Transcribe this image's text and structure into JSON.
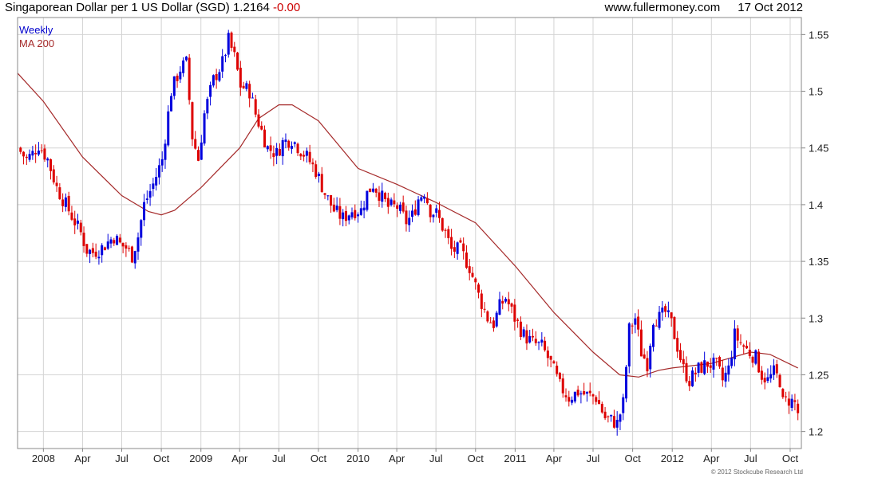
{
  "header": {
    "title": "Singaporean Dollar per 1 US Dollar (SGD)",
    "last_value": "1.2164",
    "change": "-0.00",
    "website": "www.fullermoney.com",
    "date": "17 Oct 2012"
  },
  "credit": "© 2012 Stockcube Research Ltd",
  "colors": {
    "up": "#0000dd",
    "down": "#dd0000",
    "ma": "#a52a2a",
    "grid": "#d4d4d4",
    "frame": "#888888"
  },
  "chart_data": {
    "type": "candlestick",
    "legend": [
      "Weekly",
      "MA 200"
    ],
    "legend_placement": "top-left",
    "grid": true,
    "y_axis_side": "right",
    "ylim": [
      1.185,
      1.565
    ],
    "y_ticks": [
      1.2,
      1.25,
      1.3,
      1.35,
      1.4,
      1.45,
      1.5,
      1.55
    ],
    "y_tick_labels": [
      "1.2",
      "1.25",
      "1.3",
      "1.35",
      "1.4",
      "1.45",
      "1.5",
      "1.55"
    ],
    "xlim": [
      "2007-11-02",
      "2012-10-27"
    ],
    "x_ticks": [
      {
        "date": "2008-01-01",
        "label": "2008"
      },
      {
        "date": "2008-04-01",
        "label": "Apr"
      },
      {
        "date": "2008-07-01",
        "label": "Jul"
      },
      {
        "date": "2008-10-01",
        "label": "Oct"
      },
      {
        "date": "2009-01-01",
        "label": "2009"
      },
      {
        "date": "2009-04-01",
        "label": "Apr"
      },
      {
        "date": "2009-07-01",
        "label": "Jul"
      },
      {
        "date": "2009-10-01",
        "label": "Oct"
      },
      {
        "date": "2010-01-01",
        "label": "2010"
      },
      {
        "date": "2010-04-01",
        "label": "Apr"
      },
      {
        "date": "2010-07-01",
        "label": "Jul"
      },
      {
        "date": "2010-10-01",
        "label": "Oct"
      },
      {
        "date": "2011-01-01",
        "label": "2011"
      },
      {
        "date": "2011-04-01",
        "label": "Apr"
      },
      {
        "date": "2011-07-01",
        "label": "Jul"
      },
      {
        "date": "2011-10-01",
        "label": "Oct"
      },
      {
        "date": "2012-01-01",
        "label": "2012"
      },
      {
        "date": "2012-04-01",
        "label": "Apr"
      },
      {
        "date": "2012-07-01",
        "label": "Jul"
      },
      {
        "date": "2012-10-01",
        "label": "Oct"
      }
    ],
    "close_path": [
      [
        "2007-11-02",
        1.45
      ],
      [
        "2007-11-23",
        1.44
      ],
      [
        "2007-12-07",
        1.445
      ],
      [
        "2007-12-21",
        1.453
      ],
      [
        "2008-01-11",
        1.44
      ],
      [
        "2008-02-01",
        1.415
      ],
      [
        "2008-02-22",
        1.4
      ],
      [
        "2008-03-14",
        1.385
      ],
      [
        "2008-03-28",
        1.375
      ],
      [
        "2008-04-11",
        1.36
      ],
      [
        "2008-04-25",
        1.358
      ],
      [
        "2008-05-16",
        1.362
      ],
      [
        "2008-05-30",
        1.367
      ],
      [
        "2008-06-13",
        1.372
      ],
      [
        "2008-06-27",
        1.365
      ],
      [
        "2008-07-11",
        1.362
      ],
      [
        "2008-07-25",
        1.355
      ],
      [
        "2008-08-08",
        1.372
      ],
      [
        "2008-08-22",
        1.4
      ],
      [
        "2008-09-12",
        1.418
      ],
      [
        "2008-10-03",
        1.44
      ],
      [
        "2008-10-24",
        1.5
      ],
      [
        "2008-11-14",
        1.52
      ],
      [
        "2008-11-28",
        1.525
      ],
      [
        "2008-12-12",
        1.46
      ],
      [
        "2008-12-26",
        1.44
      ],
      [
        "2009-01-09",
        1.48
      ],
      [
        "2009-01-30",
        1.51
      ],
      [
        "2009-02-20",
        1.525
      ],
      [
        "2009-03-06",
        1.545
      ],
      [
        "2009-03-20",
        1.53
      ],
      [
        "2009-04-03",
        1.505
      ],
      [
        "2009-04-24",
        1.5
      ],
      [
        "2009-05-08",
        1.48
      ],
      [
        "2009-05-22",
        1.465
      ],
      [
        "2009-06-05",
        1.45
      ],
      [
        "2009-06-26",
        1.445
      ],
      [
        "2009-07-10",
        1.455
      ],
      [
        "2009-07-31",
        1.458
      ],
      [
        "2009-08-21",
        1.448
      ],
      [
        "2009-09-04",
        1.442
      ],
      [
        "2009-09-25",
        1.43
      ],
      [
        "2009-10-16",
        1.41
      ],
      [
        "2009-11-06",
        1.395
      ],
      [
        "2009-11-27",
        1.388
      ],
      [
        "2009-12-18",
        1.395
      ],
      [
        "2010-01-08",
        1.395
      ],
      [
        "2010-01-22",
        1.41
      ],
      [
        "2010-02-05",
        1.418
      ],
      [
        "2010-02-19",
        1.41
      ],
      [
        "2010-03-12",
        1.398
      ],
      [
        "2010-04-02",
        1.398
      ],
      [
        "2010-04-23",
        1.385
      ],
      [
        "2010-05-07",
        1.39
      ],
      [
        "2010-05-21",
        1.405
      ],
      [
        "2010-06-04",
        1.412
      ],
      [
        "2010-06-18",
        1.395
      ],
      [
        "2010-07-02",
        1.392
      ],
      [
        "2010-07-23",
        1.375
      ],
      [
        "2010-08-06",
        1.36
      ],
      [
        "2010-08-27",
        1.36
      ],
      [
        "2010-09-17",
        1.345
      ],
      [
        "2010-10-08",
        1.32
      ],
      [
        "2010-10-29",
        1.3
      ],
      [
        "2010-11-12",
        1.295
      ],
      [
        "2010-11-26",
        1.31
      ],
      [
        "2010-12-10",
        1.318
      ],
      [
        "2010-12-31",
        1.3
      ],
      [
        "2011-01-21",
        1.285
      ],
      [
        "2011-02-11",
        1.278
      ],
      [
        "2011-03-04",
        1.275
      ],
      [
        "2011-03-25",
        1.26
      ],
      [
        "2011-04-15",
        1.24
      ],
      [
        "2011-05-06",
        1.23
      ],
      [
        "2011-05-27",
        1.235
      ],
      [
        "2011-06-17",
        1.232
      ],
      [
        "2011-07-08",
        1.23
      ],
      [
        "2011-07-29",
        1.212
      ],
      [
        "2011-08-12",
        1.21
      ],
      [
        "2011-08-26",
        1.207
      ],
      [
        "2011-09-09",
        1.225
      ],
      [
        "2011-09-23",
        1.29
      ],
      [
        "2011-10-07",
        1.3
      ],
      [
        "2011-10-21",
        1.27
      ],
      [
        "2011-11-04",
        1.26
      ],
      [
        "2011-11-18",
        1.3
      ],
      [
        "2011-12-02",
        1.3
      ],
      [
        "2011-12-16",
        1.305
      ],
      [
        "2011-12-30",
        1.295
      ],
      [
        "2012-01-13",
        1.275
      ],
      [
        "2012-01-27",
        1.255
      ],
      [
        "2012-02-10",
        1.245
      ],
      [
        "2012-03-02",
        1.255
      ],
      [
        "2012-03-23",
        1.26
      ],
      [
        "2012-04-13",
        1.258
      ],
      [
        "2012-04-27",
        1.245
      ],
      [
        "2012-05-11",
        1.255
      ],
      [
        "2012-05-25",
        1.285
      ],
      [
        "2012-06-08",
        1.278
      ],
      [
        "2012-06-22",
        1.272
      ],
      [
        "2012-07-13",
        1.265
      ],
      [
        "2012-07-27",
        1.25
      ],
      [
        "2012-08-10",
        1.245
      ],
      [
        "2012-08-24",
        1.252
      ],
      [
        "2012-09-07",
        1.245
      ],
      [
        "2012-09-14",
        1.225
      ],
      [
        "2012-09-28",
        1.228
      ],
      [
        "2012-10-12",
        1.225
      ],
      [
        "2012-10-19",
        1.2164
      ]
    ],
    "ma200_path": [
      [
        "2007-11-02",
        1.516
      ],
      [
        "2008-01-01",
        1.491
      ],
      [
        "2008-04-01",
        1.442
      ],
      [
        "2008-07-01",
        1.408
      ],
      [
        "2008-09-01",
        1.394
      ],
      [
        "2008-10-01",
        1.391
      ],
      [
        "2008-11-01",
        1.395
      ],
      [
        "2009-01-01",
        1.415
      ],
      [
        "2009-04-01",
        1.45
      ],
      [
        "2009-05-15",
        1.476
      ],
      [
        "2009-07-01",
        1.488
      ],
      [
        "2009-08-01",
        1.488
      ],
      [
        "2009-10-01",
        1.474
      ],
      [
        "2010-01-01",
        1.432
      ],
      [
        "2010-04-01",
        1.418
      ],
      [
        "2010-07-01",
        1.402
      ],
      [
        "2010-10-01",
        1.384
      ],
      [
        "2011-01-01",
        1.346
      ],
      [
        "2011-04-01",
        1.305
      ],
      [
        "2011-07-01",
        1.27
      ],
      [
        "2011-09-01",
        1.25
      ],
      [
        "2011-10-15",
        1.248
      ],
      [
        "2011-12-01",
        1.254
      ],
      [
        "2012-01-01",
        1.256
      ],
      [
        "2012-04-01",
        1.26
      ],
      [
        "2012-07-01",
        1.27
      ],
      [
        "2012-08-15",
        1.268
      ],
      [
        "2012-10-19",
        1.256
      ]
    ]
  }
}
